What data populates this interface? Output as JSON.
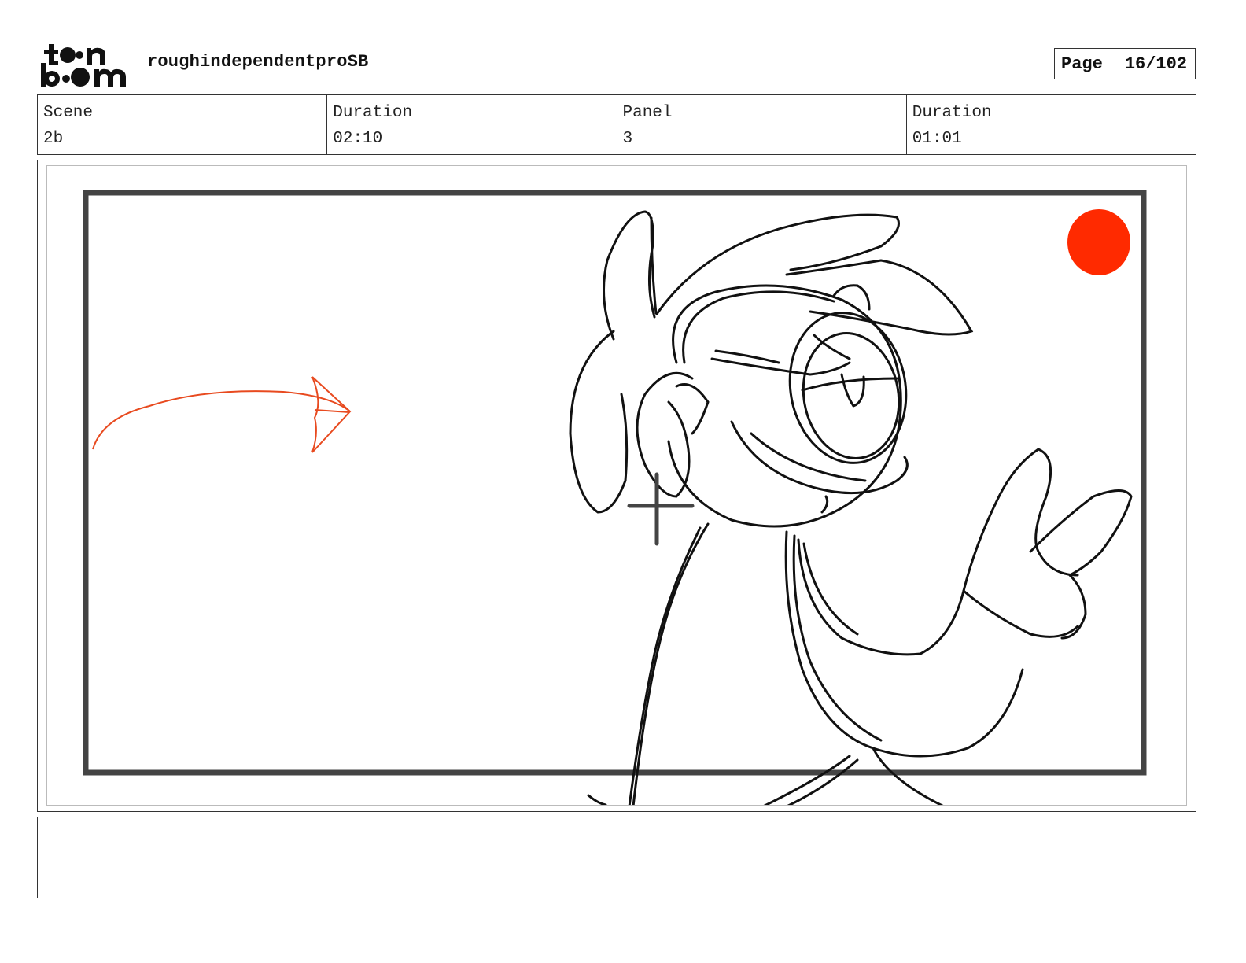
{
  "header": {
    "logo": {
      "text": "toon boom",
      "icon": "toon-boom-logo"
    },
    "project_title": "roughindependentproSB",
    "page": {
      "label": "Page",
      "value": "16/102"
    }
  },
  "info": [
    {
      "label": "Scene",
      "value": "2b"
    },
    {
      "label": "Duration",
      "value": "02:10"
    },
    {
      "label": "Panel",
      "value": "3"
    },
    {
      "label": "Duration",
      "value": "01:01"
    }
  ],
  "panel": {
    "accent_color": "#e84a1f",
    "marker_color": "#ff2a00",
    "stroke_color": "#111111",
    "frame_color": "#444444"
  },
  "notes": {
    "text": ""
  }
}
